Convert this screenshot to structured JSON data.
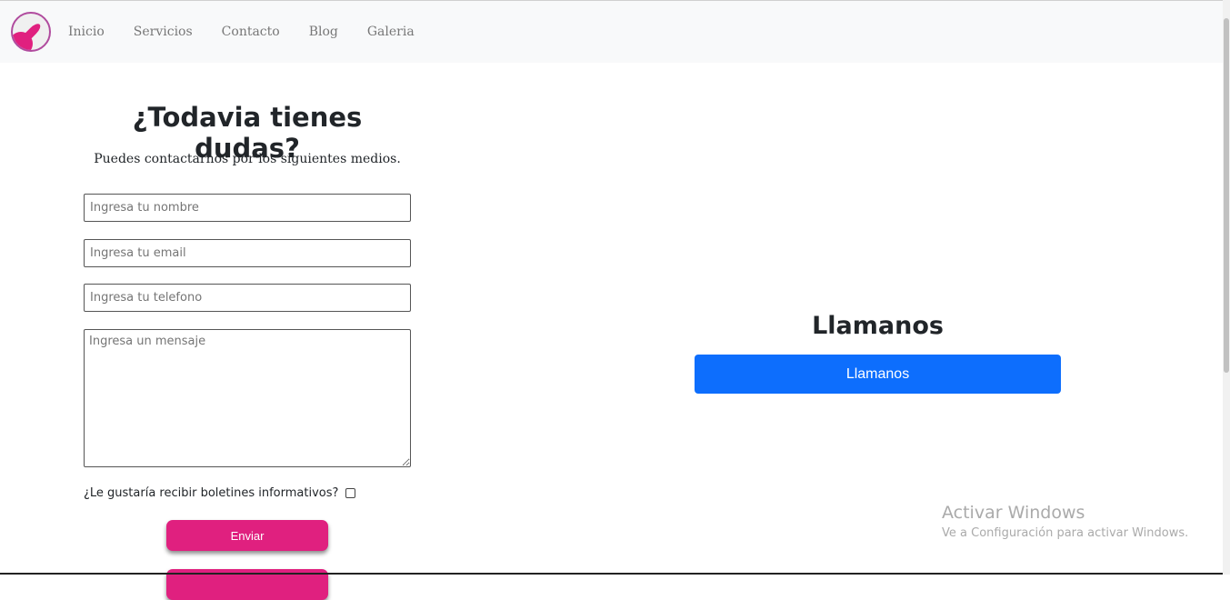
{
  "nav": {
    "links": [
      "Inicio",
      "Servicios",
      "Contacto",
      "Blog",
      "Galeria"
    ]
  },
  "form": {
    "title": "¿Todavia tienes dudas?",
    "subtitle": "Puedes contactarnos por los siguientes medios.",
    "name_placeholder": "Ingresa tu nombre",
    "email_placeholder": "Ingresa tu email",
    "phone_placeholder": "Ingresa tu telefono",
    "message_placeholder": "Ingresa un mensaje",
    "newsletter_label": "¿Le gustaría recibir boletines informativos?",
    "submit_label": "Enviar"
  },
  "call": {
    "title": "Llamanos",
    "button_label": "Llamanos"
  },
  "watermark": {
    "title": "Activar Windows",
    "subtitle": "Ve a Configuración para activar Windows."
  }
}
